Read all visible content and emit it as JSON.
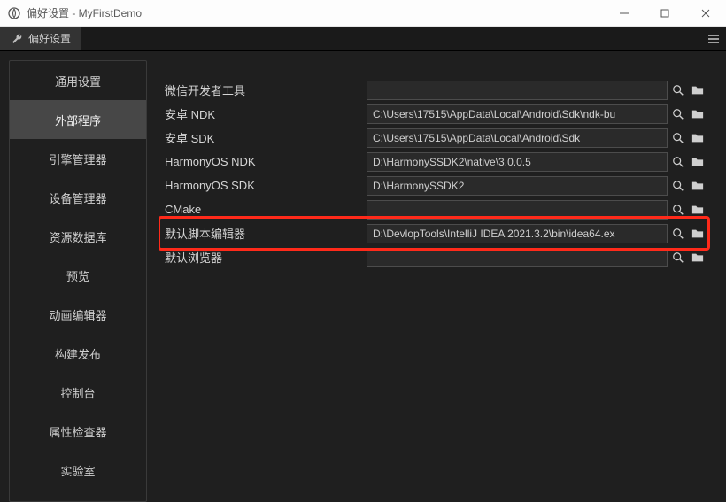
{
  "window": {
    "title": "偏好设置 - MyFirstDemo"
  },
  "tab": {
    "label": "偏好设置"
  },
  "sidebar": {
    "items": [
      {
        "label": "通用设置"
      },
      {
        "label": "外部程序"
      },
      {
        "label": "引擎管理器"
      },
      {
        "label": "设备管理器"
      },
      {
        "label": "资源数据库"
      },
      {
        "label": "预览"
      },
      {
        "label": "动画编辑器"
      },
      {
        "label": "构建发布"
      },
      {
        "label": "控制台"
      },
      {
        "label": "属性检查器"
      },
      {
        "label": "实验室"
      }
    ],
    "activeIndex": 1
  },
  "form": {
    "rows": [
      {
        "label": "微信开发者工具",
        "value": ""
      },
      {
        "label": "安卓 NDK",
        "value": "C:\\Users\\17515\\AppData\\Local\\Android\\Sdk\\ndk-bu"
      },
      {
        "label": "安卓 SDK",
        "value": "C:\\Users\\17515\\AppData\\Local\\Android\\Sdk"
      },
      {
        "label": "HarmonyOS NDK",
        "value": "D:\\HarmonySSDK2\\native\\3.0.0.5"
      },
      {
        "label": "HarmonyOS SDK",
        "value": "D:\\HarmonySSDK2"
      },
      {
        "label": "CMake",
        "value": ""
      },
      {
        "label": "默认脚本编辑器",
        "value": "D:\\DevlopTools\\IntelliJ IDEA 2021.3.2\\bin\\idea64.ex"
      },
      {
        "label": "默认浏览器",
        "value": ""
      }
    ]
  },
  "highlightRowIndex": 6,
  "colors": {
    "highlight": "#ff2a1a",
    "bg": "#1f1f1f",
    "inputBg": "#2a2a2a",
    "inputBorder": "#4c4c4c",
    "activeNav": "#474747"
  }
}
